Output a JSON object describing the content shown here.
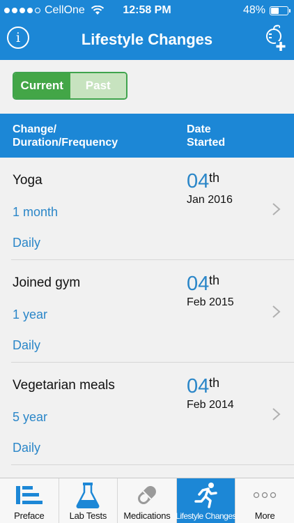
{
  "status_bar": {
    "carrier": "CellOne",
    "time": "12:58 PM",
    "battery": "48%",
    "battery_level": 0.48,
    "signal_bars": 4
  },
  "nav": {
    "title": "Lifestyle Changes",
    "info_label": "i",
    "left_icon": "info-icon",
    "right_icon": "add-lifestyle-icon"
  },
  "segment": {
    "options": [
      "Current",
      "Past"
    ],
    "selected": "Current"
  },
  "table_header": {
    "left_line1": "Change/",
    "left_line2": "Duration/Frequency",
    "right_line1": "Date",
    "right_line2": "Started"
  },
  "items": [
    {
      "name": "Yoga",
      "duration": "1 month",
      "frequency": "Daily",
      "day": "04",
      "suffix": "th",
      "month_year": "Jan 2016"
    },
    {
      "name": "Joined gym",
      "duration": "1 year",
      "frequency": "Daily",
      "day": "04",
      "suffix": "th",
      "month_year": "Feb 2015"
    },
    {
      "name": "Vegetarian meals",
      "duration": "5 year",
      "frequency": "Daily",
      "day": "04",
      "suffix": "th",
      "month_year": "Feb 2014"
    }
  ],
  "tabs": [
    {
      "label": "Preface",
      "icon": "preface-icon",
      "active": false
    },
    {
      "label": "Lab Tests",
      "icon": "flask-icon",
      "active": false
    },
    {
      "label": "Medications",
      "icon": "pill-icon",
      "active": false
    },
    {
      "label": "Lifestyle Changes",
      "icon": "running-person-icon",
      "active": true
    },
    {
      "label": "More",
      "icon": "more-dots-icon",
      "active": false
    }
  ],
  "colors": {
    "primary": "#1c87d6",
    "accent_blue_text": "#2a86c8",
    "segment_active": "#43a647",
    "segment_inactive": "#c7e3bf"
  }
}
